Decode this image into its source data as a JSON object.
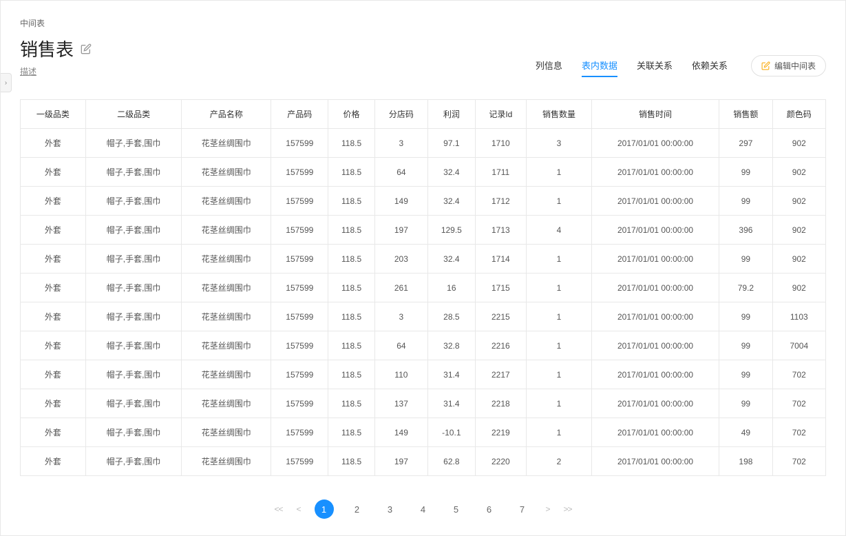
{
  "breadcrumb": "中间表",
  "title": "销售表",
  "desc_label": "描述",
  "tabs": [
    {
      "label": "列信息",
      "active": false
    },
    {
      "label": "表内数据",
      "active": true
    },
    {
      "label": "关联关系",
      "active": false
    },
    {
      "label": "依赖关系",
      "active": false
    }
  ],
  "edit_button": "编辑中间表",
  "columns": [
    "一级品类",
    "二级品类",
    "产品名称",
    "产品码",
    "价格",
    "分店码",
    "利润",
    "记录Id",
    "销售数量",
    "销售时间",
    "销售额",
    "颜色码"
  ],
  "rows": [
    [
      "外套",
      "帽子,手套,围巾",
      "花茎丝绸围巾",
      "157599",
      "118.5",
      "3",
      "97.1",
      "1710",
      "3",
      "2017/01/01 00:00:00",
      "297",
      "902"
    ],
    [
      "外套",
      "帽子,手套,围巾",
      "花茎丝绸围巾",
      "157599",
      "118.5",
      "64",
      "32.4",
      "1711",
      "1",
      "2017/01/01 00:00:00",
      "99",
      "902"
    ],
    [
      "外套",
      "帽子,手套,围巾",
      "花茎丝绸围巾",
      "157599",
      "118.5",
      "149",
      "32.4",
      "1712",
      "1",
      "2017/01/01 00:00:00",
      "99",
      "902"
    ],
    [
      "外套",
      "帽子,手套,围巾",
      "花茎丝绸围巾",
      "157599",
      "118.5",
      "197",
      "129.5",
      "1713",
      "4",
      "2017/01/01 00:00:00",
      "396",
      "902"
    ],
    [
      "外套",
      "帽子,手套,围巾",
      "花茎丝绸围巾",
      "157599",
      "118.5",
      "203",
      "32.4",
      "1714",
      "1",
      "2017/01/01 00:00:00",
      "99",
      "902"
    ],
    [
      "外套",
      "帽子,手套,围巾",
      "花茎丝绸围巾",
      "157599",
      "118.5",
      "261",
      "16",
      "1715",
      "1",
      "2017/01/01 00:00:00",
      "79.2",
      "902"
    ],
    [
      "外套",
      "帽子,手套,围巾",
      "花茎丝绸围巾",
      "157599",
      "118.5",
      "3",
      "28.5",
      "2215",
      "1",
      "2017/01/01 00:00:00",
      "99",
      "1103"
    ],
    [
      "外套",
      "帽子,手套,围巾",
      "花茎丝绸围巾",
      "157599",
      "118.5",
      "64",
      "32.8",
      "2216",
      "1",
      "2017/01/01 00:00:00",
      "99",
      "7004"
    ],
    [
      "外套",
      "帽子,手套,围巾",
      "花茎丝绸围巾",
      "157599",
      "118.5",
      "110",
      "31.4",
      "2217",
      "1",
      "2017/01/01 00:00:00",
      "99",
      "702"
    ],
    [
      "外套",
      "帽子,手套,围巾",
      "花茎丝绸围巾",
      "157599",
      "118.5",
      "137",
      "31.4",
      "2218",
      "1",
      "2017/01/01 00:00:00",
      "99",
      "702"
    ],
    [
      "外套",
      "帽子,手套,围巾",
      "花茎丝绸围巾",
      "157599",
      "118.5",
      "149",
      "-10.1",
      "2219",
      "1",
      "2017/01/01 00:00:00",
      "49",
      "702"
    ],
    [
      "外套",
      "帽子,手套,围巾",
      "花茎丝绸围巾",
      "157599",
      "118.5",
      "197",
      "62.8",
      "2220",
      "2",
      "2017/01/01 00:00:00",
      "198",
      "702"
    ]
  ],
  "pagination": {
    "first": "<<",
    "prev": "<",
    "next": ">",
    "last": ">>",
    "pages": [
      "1",
      "2",
      "3",
      "4",
      "5",
      "6",
      "7"
    ],
    "active": 1
  }
}
